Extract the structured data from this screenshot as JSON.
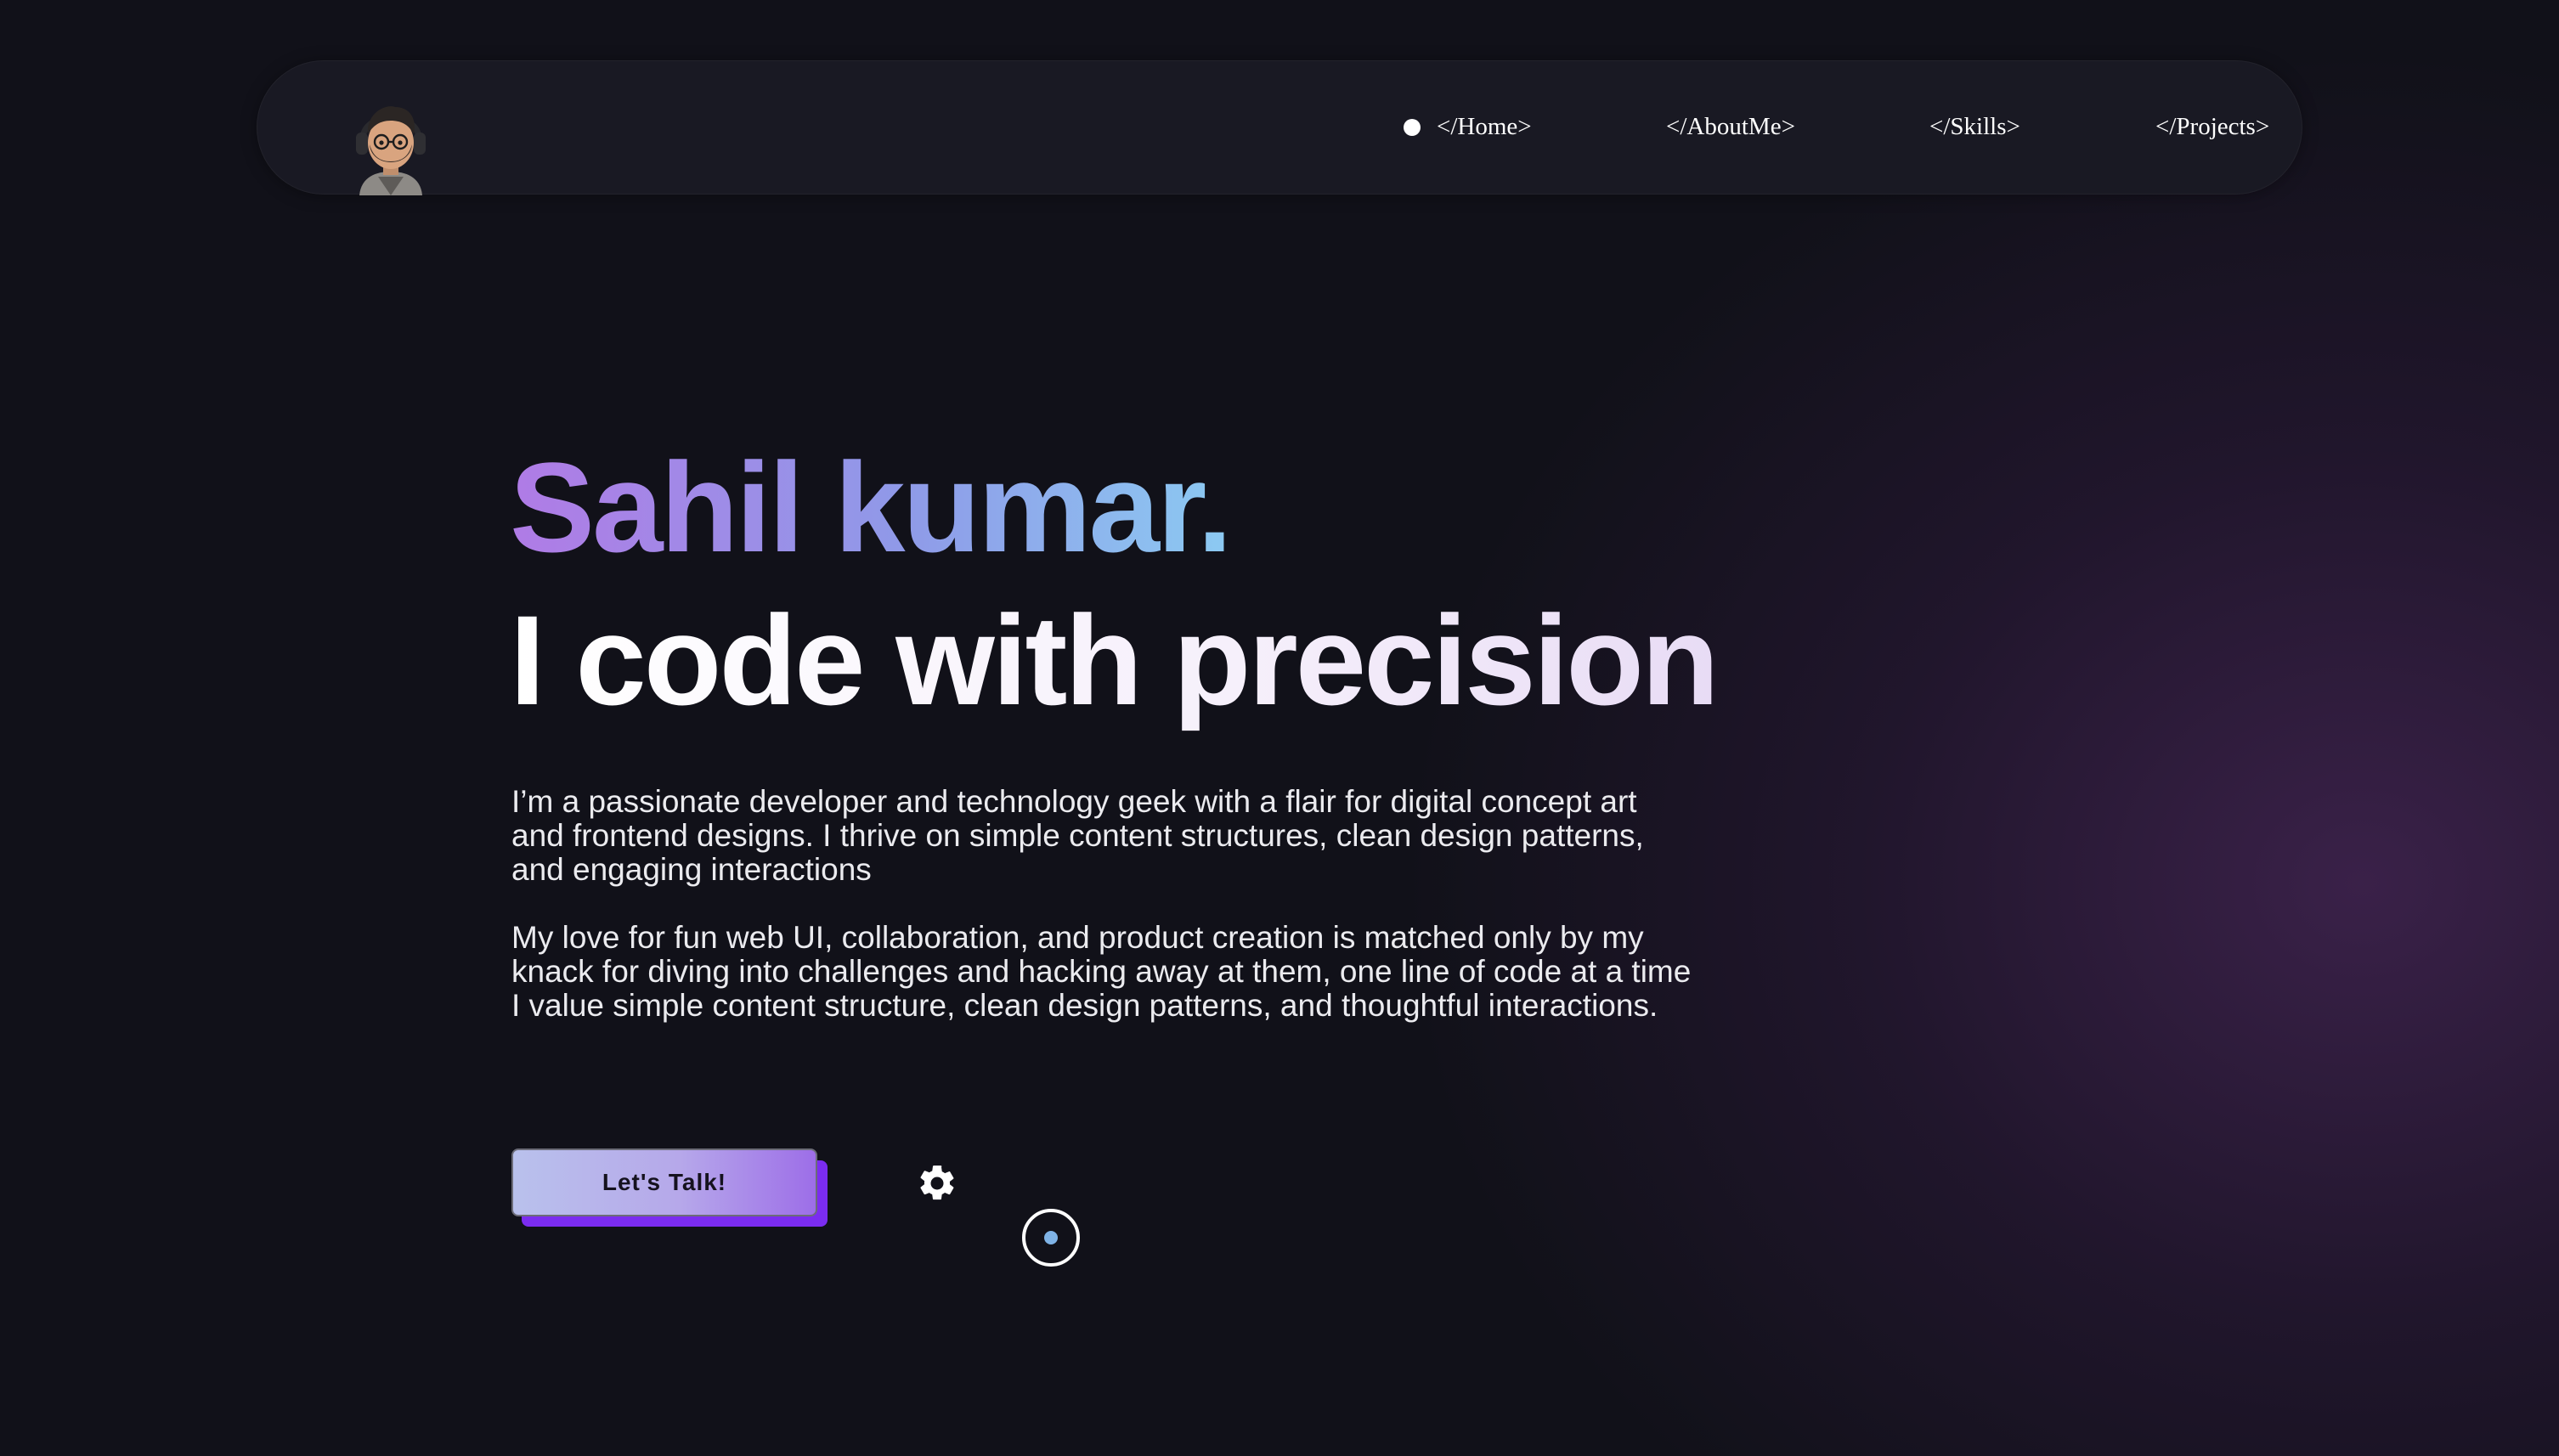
{
  "nav": {
    "active_indicator": "active-dot-icon",
    "links": [
      {
        "label": "</Home>"
      },
      {
        "label": "</AboutMe>"
      },
      {
        "label": "</Skills>"
      },
      {
        "label": "</Projects>"
      }
    ],
    "avatar_icon": "memoji-avatar-icon"
  },
  "hero": {
    "name": "Sahil kumar.",
    "headline": "I code with precision",
    "paragraphs": [
      "I’m a passionate developer and technology geek with a flair for digital concept art and frontend designs. I thrive on simple content structures, clean design patterns, and engaging interactions",
      "My love for fun web UI, collaboration, and product creation is matched only by my knack for diving into challenges and hacking away at them, one line of code at a time I value simple content structure, clean design patterns, and thoughtful interactions."
    ],
    "cta_label": "Let's Talk!",
    "settings_icon": "gear-icon",
    "scroll_icon": "scroll-indicator-icon"
  },
  "colors": {
    "background": "#111119",
    "accent_purple": "#7b2cf0",
    "name_gradient_start": "#b07be6",
    "name_gradient_end": "#8ccaf2"
  }
}
